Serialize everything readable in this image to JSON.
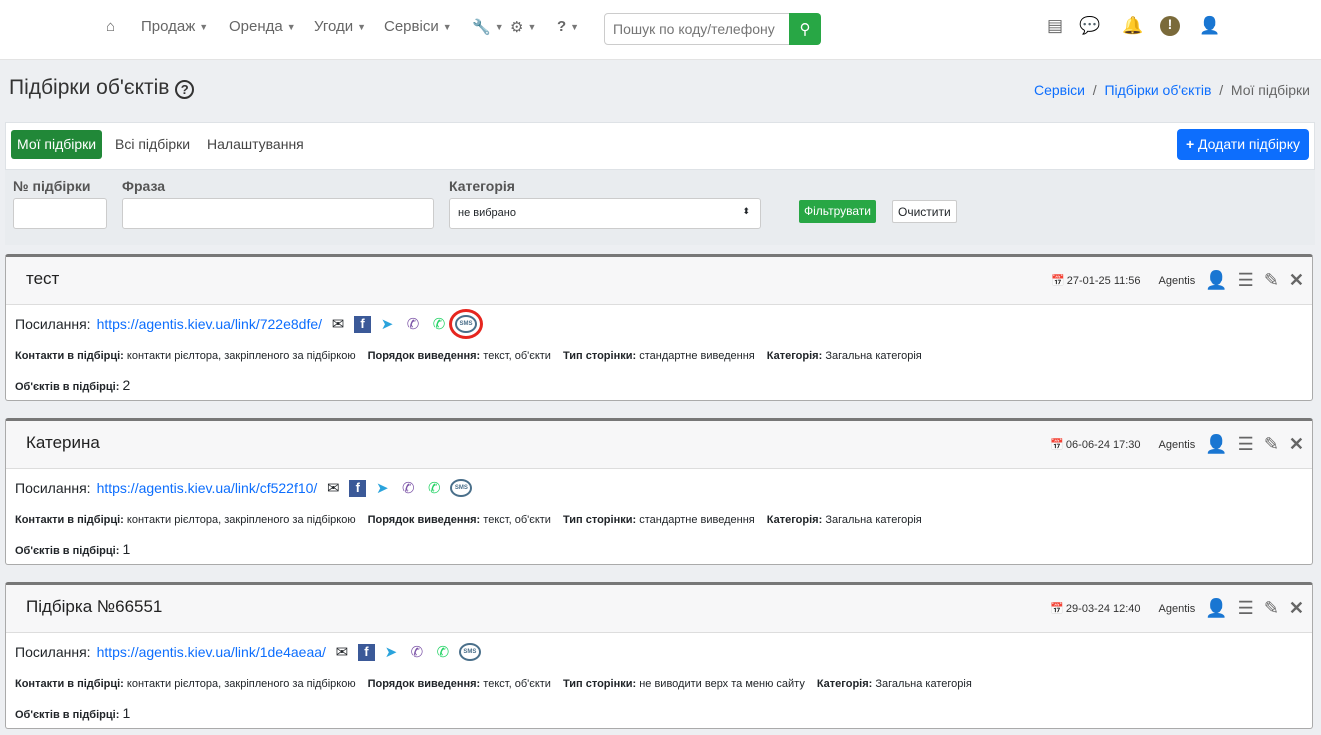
{
  "nav": {
    "items": [
      {
        "label": "Продаж"
      },
      {
        "label": "Оренда"
      },
      {
        "label": "Угоди"
      },
      {
        "label": "Сервіси"
      }
    ],
    "search_placeholder": "Пошук по коду/телефону"
  },
  "page": {
    "title": "Підбірки об'єктів",
    "breadcrumb": [
      "Сервіси",
      "Підбірки об'єктів",
      "Мої підбірки"
    ]
  },
  "tabs": [
    {
      "label": "Мої підбірки",
      "active": true
    },
    {
      "label": "Всі підбірки"
    },
    {
      "label": "Налаштування"
    }
  ],
  "add_button": "Додати підбірку",
  "filters": {
    "number_label": "№ підбірки",
    "phrase_label": "Фраза",
    "category_label": "Категорія",
    "category_value": "не вибрано",
    "filter_button": "Фільтрувати",
    "clear_button": "Очистити"
  },
  "labels": {
    "link": "Посилання:",
    "contacts": "Контакти в підбірці:",
    "order": "Порядок виведення:",
    "page_type": "Тип сторінки:",
    "category": "Категорія:",
    "objects": "Об'єктів в підбірці:",
    "sms": "SMS"
  },
  "cards": [
    {
      "title": "тест",
      "date": "27-01-25 11:56",
      "author": "Agentis",
      "link": "https://agentis.kiev.ua/link/722e8dfe/",
      "contacts": "контакти рієлтора, закріпленого за підбіркою",
      "order": "текст, об'єкти",
      "page_type": "стандартне виведення",
      "category": "Загальна категорія",
      "objects": "2"
    },
    {
      "title": "Катерина",
      "date": "06-06-24 17:30",
      "author": "Agentis",
      "link": "https://agentis.kiev.ua/link/cf522f10/",
      "contacts": "контакти рієлтора, закріпленого за підбіркою",
      "order": "текст, об'єкти",
      "page_type": "стандартне виведення",
      "category": "Загальна категорія",
      "objects": "1"
    },
    {
      "title": "Підбірка №66551",
      "date": "29-03-24 12:40",
      "author": "Agentis",
      "link": "https://agentis.kiev.ua/link/1de4aeaa/",
      "contacts": "контакти рієлтора, закріпленого за підбіркою",
      "order": "текст, об'єкти",
      "page_type": "не виводити верх та меню сайту",
      "category": "Загальна категорія",
      "objects": "1"
    }
  ]
}
